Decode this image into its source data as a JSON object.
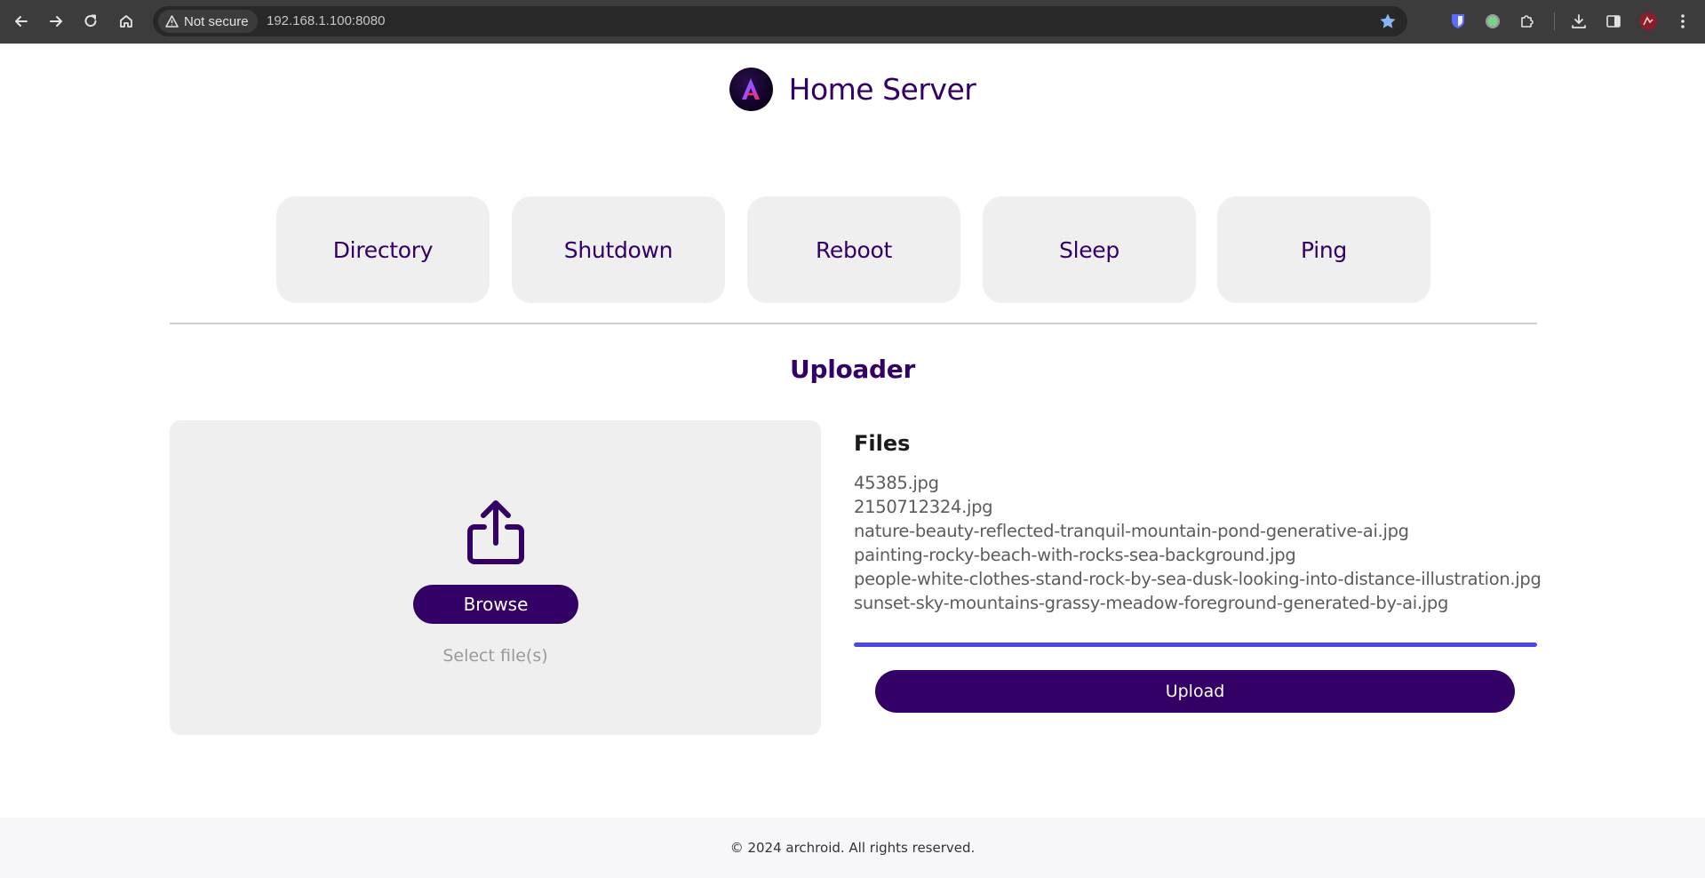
{
  "browser": {
    "security_label": "Not secure",
    "url": "192.168.1.100:8080"
  },
  "header": {
    "title": "Home Server",
    "logo_letter": "A"
  },
  "nav": {
    "directory": "Directory",
    "shutdown": "Shutdown",
    "reboot": "Reboot",
    "sleep": "Sleep",
    "ping": "Ping"
  },
  "uploader": {
    "title": "Uploader",
    "browse_label": "Browse",
    "select_text": "Select file(s)",
    "files_title": "Files",
    "files": [
      "45385.jpg",
      "2150712324.jpg",
      "nature-beauty-reflected-tranquil-mountain-pond-generative-ai.jpg",
      "painting-rocky-beach-with-rocks-sea-background.jpg",
      "people-white-clothes-stand-rock-by-sea-dusk-looking-into-distance-illustration.jpg",
      "sunset-sky-mountains-grassy-meadow-foreground-generated-by-ai.jpg"
    ],
    "progress_percent": 100,
    "upload_label": "Upload"
  },
  "footer": {
    "text": "© 2024 archroid. All rights reserved."
  },
  "colors": {
    "brand": "#330066",
    "progress": "#4f46e5",
    "tile": "#efefef"
  }
}
